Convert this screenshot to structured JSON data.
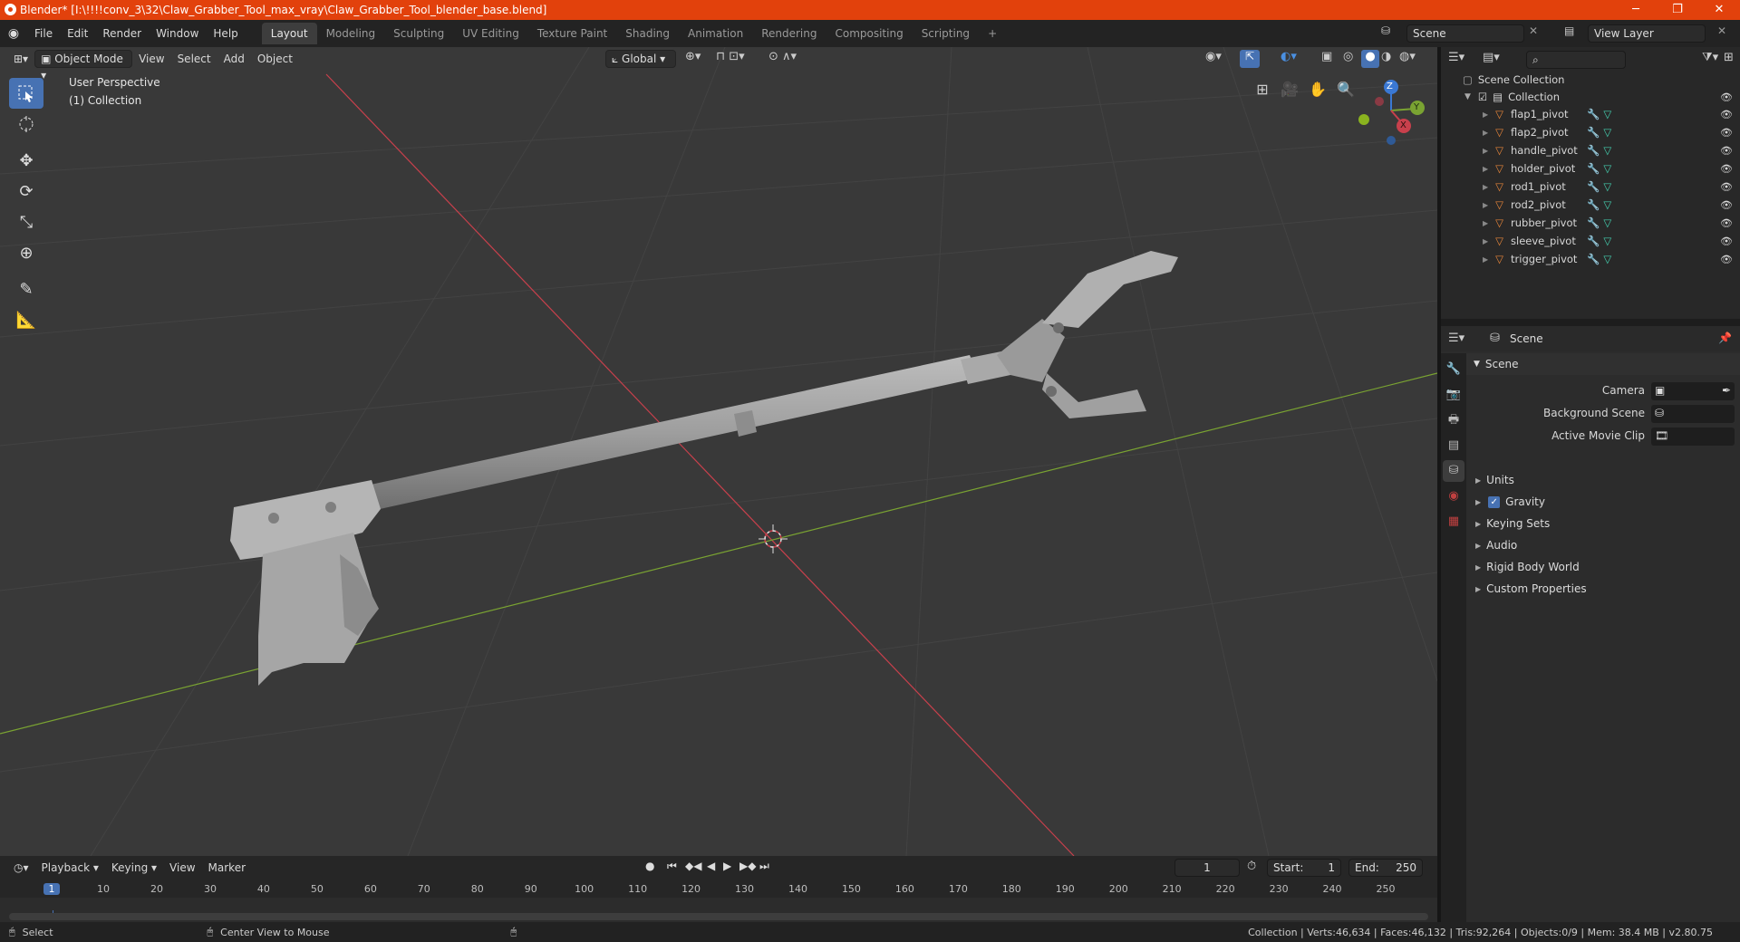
{
  "window": {
    "title": "Blender* [I:\\!!!!conv_3\\32\\Claw_Grabber_Tool_max_vray\\Claw_Grabber_Tool_blender_base.blend]",
    "minimize": "─",
    "maximize": "❐",
    "close": "✕"
  },
  "menu": {
    "items": [
      "File",
      "Edit",
      "Render",
      "Window",
      "Help"
    ],
    "workspaces": [
      "Layout",
      "Modeling",
      "Sculpting",
      "UV Editing",
      "Texture Paint",
      "Shading",
      "Animation",
      "Rendering",
      "Compositing",
      "Scripting"
    ],
    "add_workspace": "+",
    "scene": "Scene",
    "view_layer": "View Layer"
  },
  "viewport": {
    "mode": "Object Mode",
    "menus": [
      "View",
      "Select",
      "Add",
      "Object"
    ],
    "orientation": "Global",
    "overlay_title": "User Perspective",
    "overlay_sub": "(1) Collection",
    "gizmo_axes": {
      "z": "Z",
      "y": "Y",
      "x": "X"
    },
    "colors": {
      "x_axis": "#c8404c",
      "y_axis": "#7aa332",
      "z_axis": "#3a78d4",
      "active": "#4772b3"
    }
  },
  "outliner": {
    "root": "Scene Collection",
    "collection": "Collection",
    "objects": [
      "flap1_pivot",
      "flap2_pivot",
      "handle_pivot",
      "holder_pivot",
      "rod1_pivot",
      "rod2_pivot",
      "rubber_pivot",
      "sleeve_pivot",
      "trigger_pivot"
    ]
  },
  "properties": {
    "context": "Scene",
    "panel": "Scene",
    "fields": [
      {
        "label": "Camera"
      },
      {
        "label": "Background Scene"
      },
      {
        "label": "Active Movie Clip"
      }
    ],
    "subpanels": [
      "Units",
      "Gravity",
      "Keying Sets",
      "Audio",
      "Rigid Body World",
      "Custom Properties"
    ]
  },
  "timeline": {
    "menus": [
      "Playback",
      "Keying",
      "View",
      "Marker"
    ],
    "current_frame": "1",
    "start_label": "Start:",
    "start": "1",
    "end_label": "End:",
    "end": "250",
    "ruler": [
      "1",
      "10",
      "20",
      "30",
      "40",
      "50",
      "60",
      "70",
      "80",
      "90",
      "100",
      "110",
      "120",
      "130",
      "140",
      "150",
      "160",
      "170",
      "180",
      "190",
      "200",
      "210",
      "220",
      "230",
      "240",
      "250"
    ]
  },
  "status": {
    "left1": "Select",
    "left2": "Center View to Mouse",
    "stats": "Collection | Verts:46,634 | Faces:46,132 | Tris:92,264 | Objects:0/9 | Mem: 38.4 MB | v2.80.75"
  }
}
